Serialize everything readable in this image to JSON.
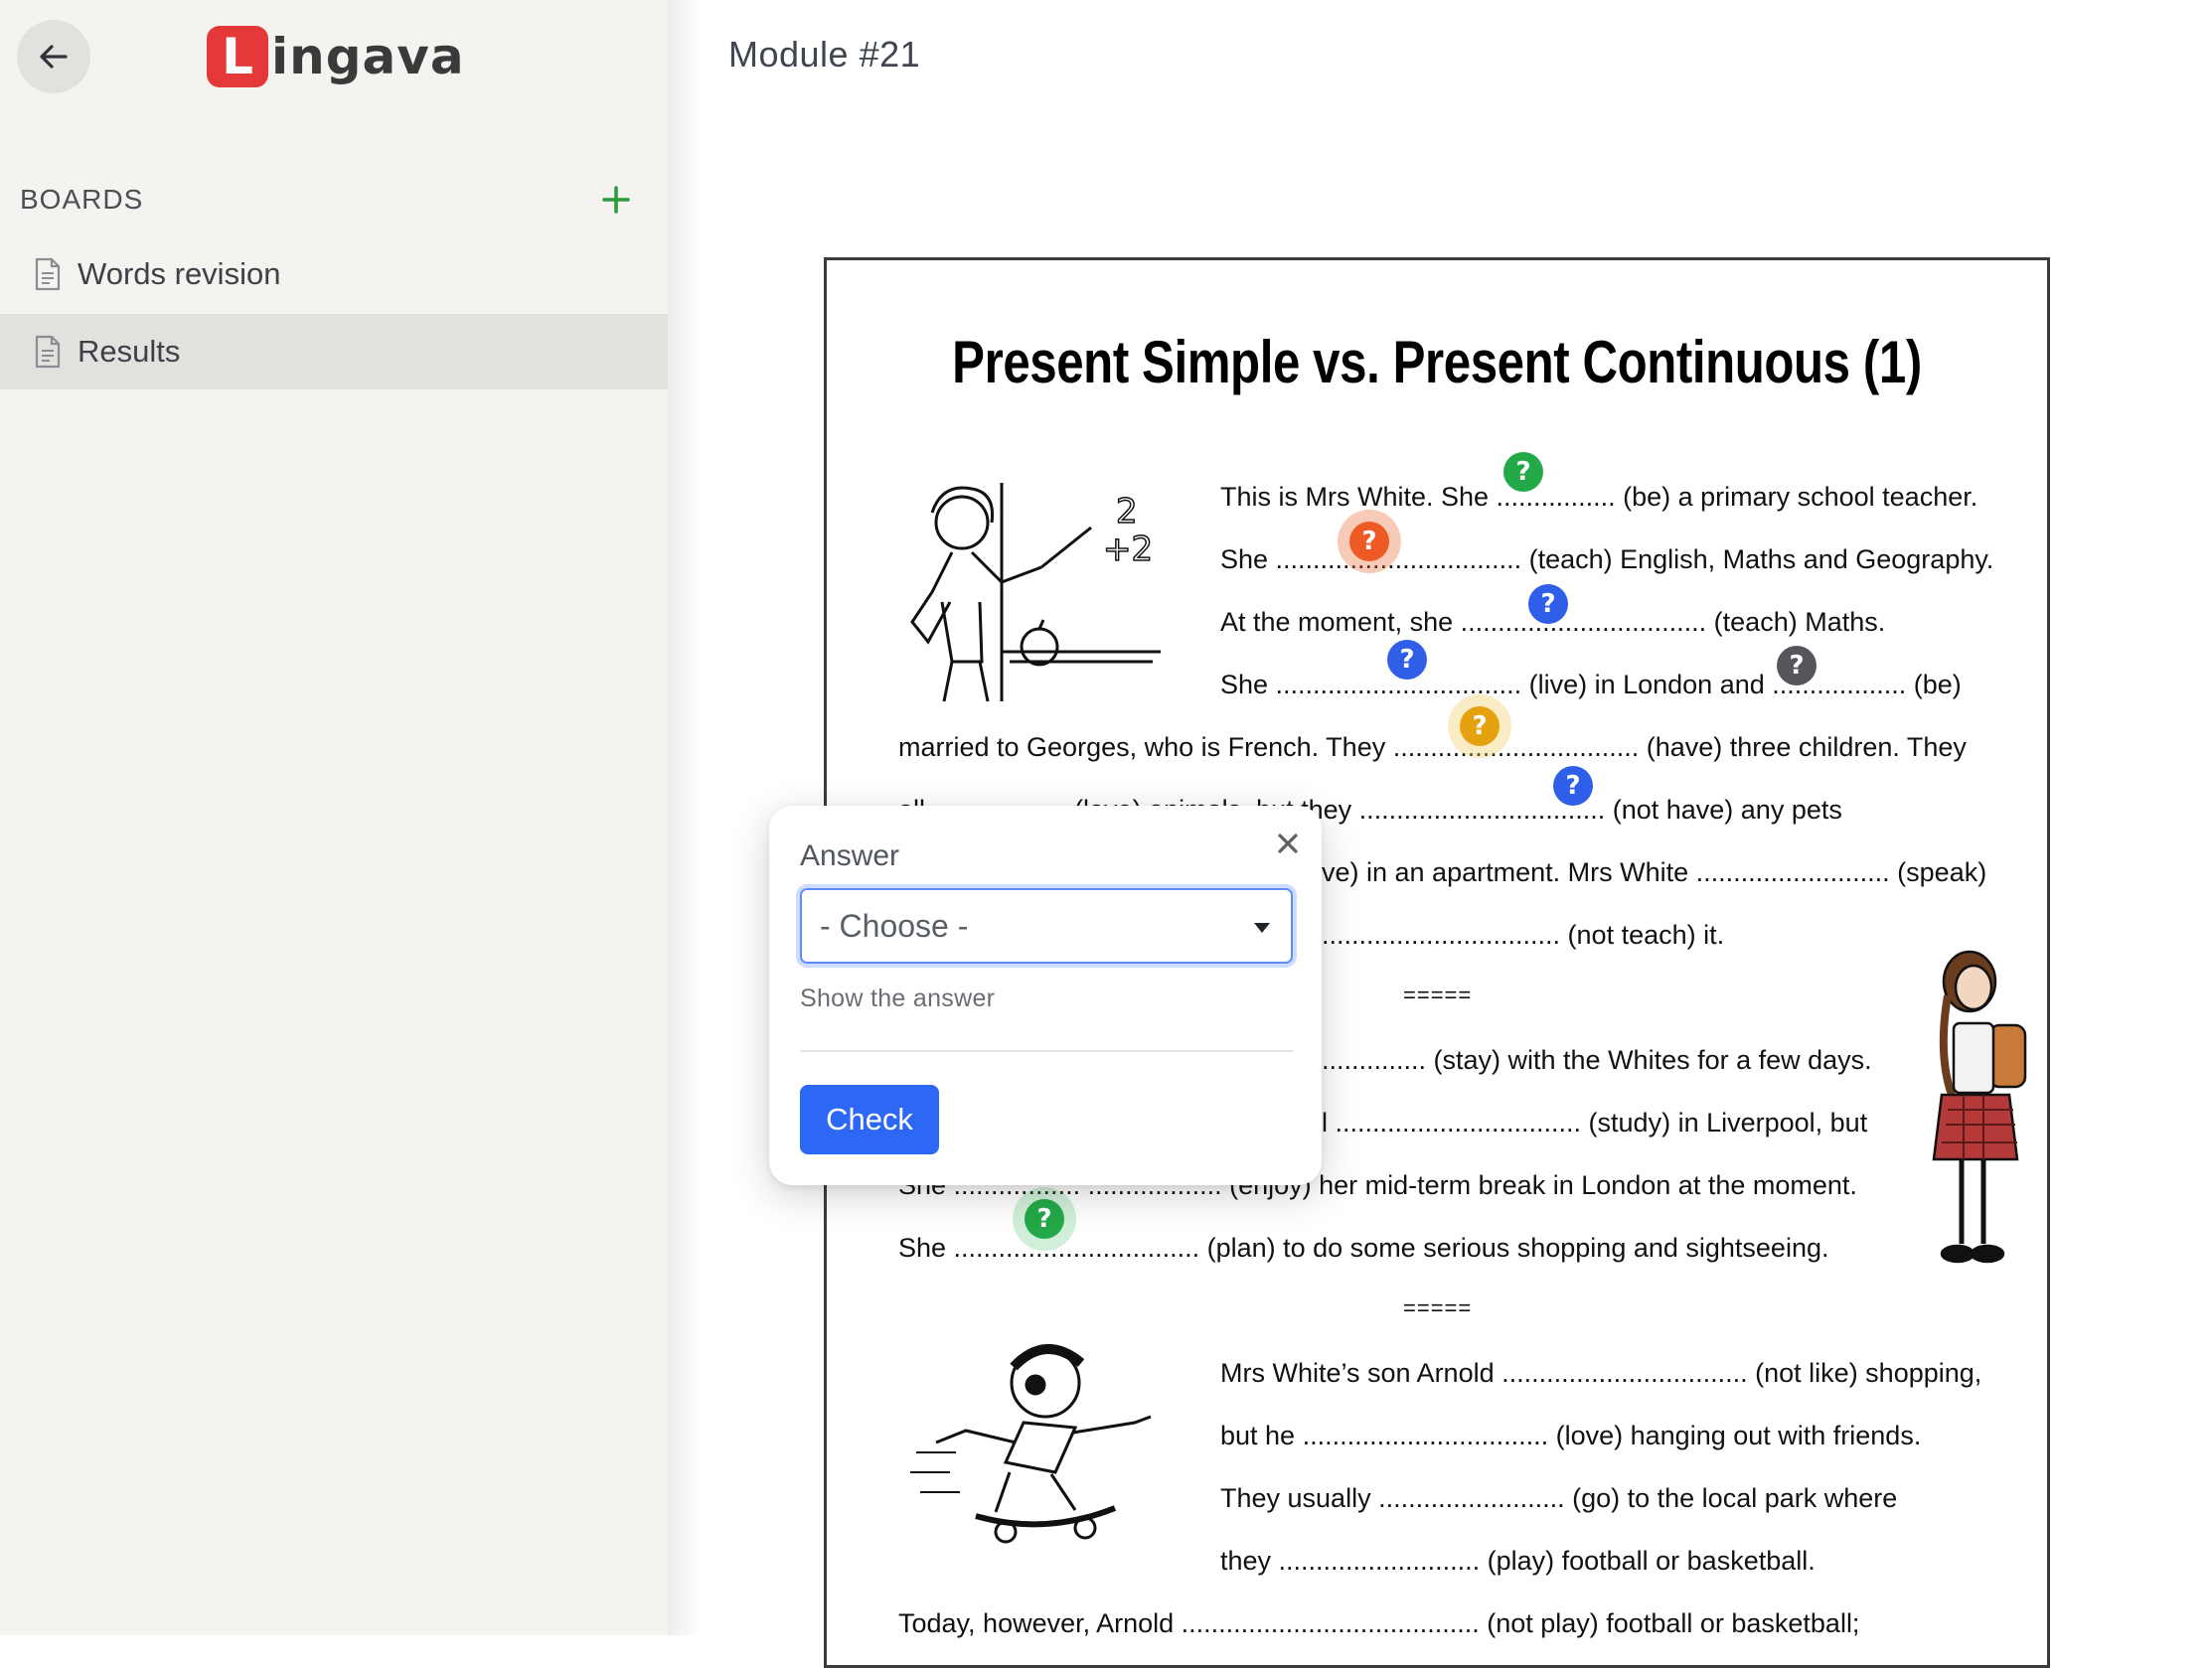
{
  "app": {
    "logo_letter": "L",
    "logo_text": "ingava",
    "back_icon": "arrow-left-icon"
  },
  "sidebar": {
    "heading": "BOARDS",
    "add_icon": "plus-icon",
    "items": [
      {
        "label": "Words revision",
        "icon": "document-icon",
        "active": false
      },
      {
        "label": "Results",
        "icon": "document-icon",
        "active": true
      }
    ]
  },
  "main": {
    "module_title": "Module #21"
  },
  "worksheet": {
    "title": "Present Simple vs. Present Continuous (1)",
    "lines": [
      "This is Mrs White. She ................ (be) a primary school teacher.",
      "She ................................. (teach) English, Maths and Geography.",
      "At the moment, she ................................. (teach) Maths.",
      "She ................................. (live) in London and .................. (be)",
      "married to Georges, who is French. They ................................. (have) three children. They",
      "all .................. (love) animals, but they ................................. (not have) any pets",
      "ve) in an apartment. Mrs White .......................... (speak)",
      "................................ (not teach) it.",
      "=====",
      ".............. (stay) with the Whites for a few days.",
      "l ................................. (study) in Liverpool,  but",
      "She ................. .................. (enjoy) her mid-term break in London at the moment.",
      "She ................................. (plan) to do some serious shopping and sightseeing.",
      "=====",
      "Mrs White’s son Arnold ................................. (not like) shopping,",
      "but he ................................. (love) hanging out with friends.",
      "They usually ......................... (go) to the local park where",
      "they ........................... (play) football or basketball.",
      "Today, however, Arnold ........................................ (not play) football or basketball;"
    ],
    "marker_symbol": "?",
    "marker_colors": {
      "green": "#23a948",
      "orange": "#ee5a24",
      "blue": "#2f5fe8",
      "gray": "#55565c",
      "yellow": "#e6a10f"
    }
  },
  "popover": {
    "label": "Answer",
    "close_icon": "close-icon",
    "select_value": "- Choose -",
    "show_answer": "Show the answer",
    "check_label": "Check"
  }
}
